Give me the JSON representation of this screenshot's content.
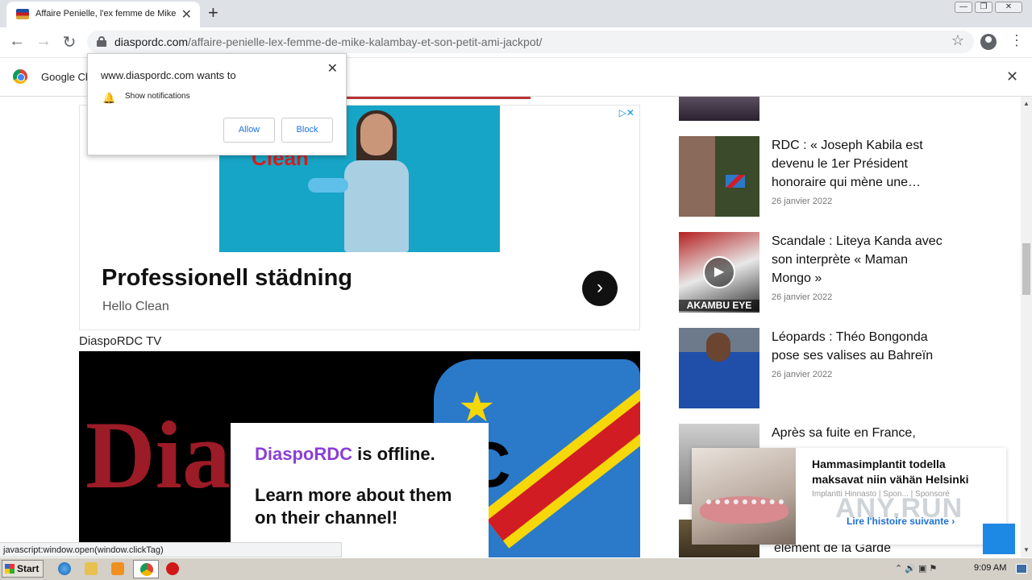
{
  "browser": {
    "tab_title": "Affaire Penielle, l'ex femme de Mike K",
    "tab_close": "✕",
    "new_tab": "+",
    "url_host": "diaspordc.com",
    "url_path": "/affaire-penielle-lex-femme-de-mike-kalambay-et-son-petit-ami-jackpot/",
    "back": "←",
    "forward": "→",
    "reload": "↻",
    "star": "☆",
    "menu": "⋮",
    "win_min": "—",
    "win_max": "❐",
    "win_close": "✕"
  },
  "infobar": {
    "text": "Google Ch",
    "close": "✕"
  },
  "notification": {
    "title": "www.diaspordc.com wants to",
    "permission": "Show notifications",
    "allow": "Allow",
    "block": "Block",
    "close": "✕"
  },
  "ad": {
    "brand_logo": "Clean",
    "title": "Professionell städning",
    "subtitle": "Hello Clean",
    "arrow": "›",
    "adchoices": "▷✕"
  },
  "tv": {
    "label": "DiaspoRDC TV",
    "bg_left": "Dia",
    "bg_right": "DC",
    "offline_brand": "DiaspoRDC",
    "offline_rest": " is offline.",
    "learn_more": "Learn more about them on their channel!"
  },
  "status_bar": "javascript:window.open(window.clickTag)",
  "sidebar": {
    "items": [
      {
        "title": "RDC : « Joseph Kabila est devenu le 1er Président honoraire qui mène une…",
        "date": "26 janvier 2022"
      },
      {
        "title": "Scandale : Liteya Kanda avec son interprète « Maman Mongo »",
        "date": "26 janvier 2022",
        "thumb_caption": "AKAMBU EYE"
      },
      {
        "title": "Léopards : Théo Bongonda pose ses valises au Bahreïn",
        "date": "26 janvier 2022"
      },
      {
        "title": "Après sa fuite en France,",
        "date": ""
      }
    ],
    "bottom_text": "élément de la Garde"
  },
  "sponsored": {
    "headline": "Hammasimplantit todella maksavat niin vähän Helsinki",
    "source": "Implantti Hinnasto | Spon...",
    "sponsored": "| Sponsoré",
    "cta": "Lire l'histoire suivante ›",
    "watermark": "ANY.RUN"
  },
  "taskbar": {
    "start": "Start",
    "time": "9:09 AM"
  },
  "colors": {
    "accent_purple": "#8b3fd6",
    "ad_bg": "#16a5c6",
    "link_blue": "#1a73e8"
  }
}
